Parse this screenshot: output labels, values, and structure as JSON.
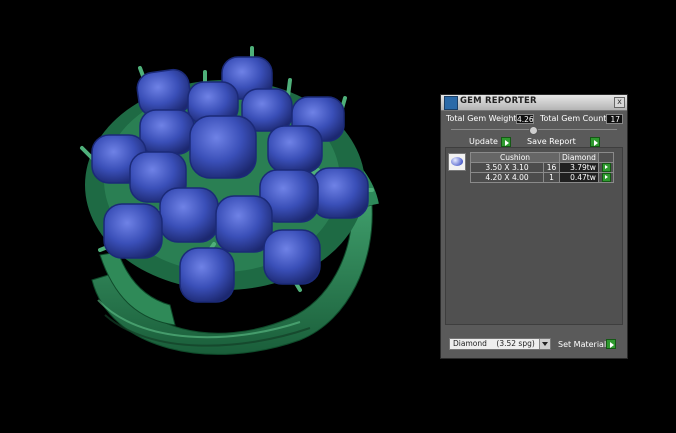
{
  "panel": {
    "title": "GEM REPORTER",
    "close_symbol": "x",
    "icon": "gem-reporter-icon",
    "total_gem_weight_label": "Total Gem Weight",
    "total_gem_weight_value": "4.26",
    "total_gem_count_label": "Total Gem Count",
    "total_gem_count_value": "17",
    "update_label": "Update",
    "save_report_label": "Save Report",
    "table": {
      "headers": [
        "Cushion",
        "Diamond"
      ],
      "rows": [
        {
          "size": "3.50 X 3.10",
          "count": "16",
          "weight": "3.79tw"
        },
        {
          "size": "4.20 X 4.00",
          "count": "1",
          "weight": "0.47tw"
        }
      ]
    },
    "material_option": "Diamond    (3.52 spg)",
    "set_material_label": "Set Material"
  },
  "colors": {
    "background": "#000000",
    "metal": "#2e8a5a",
    "gem": "#3a4fb8",
    "panel": "#5a5a5a",
    "go_button": "#2f9a2f"
  }
}
